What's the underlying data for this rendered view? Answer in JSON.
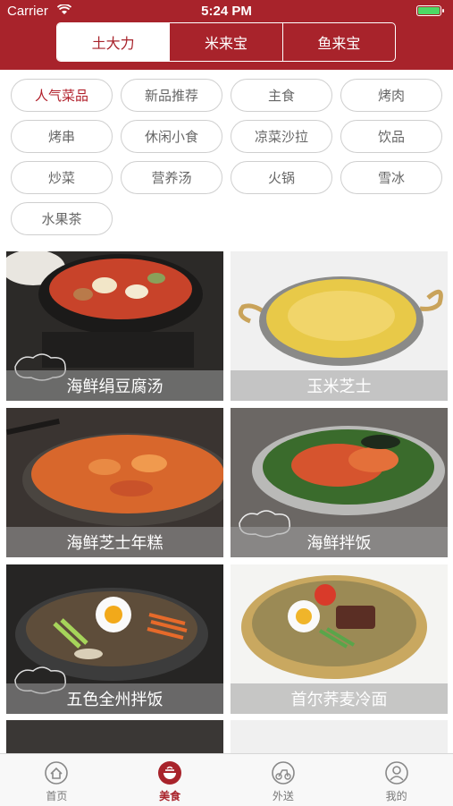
{
  "status_bar": {
    "carrier": "Carrier",
    "time": "5:24 PM"
  },
  "segments": [
    "土大力",
    "米来宝",
    "鱼来宝"
  ],
  "categories": [
    "人气菜品",
    "新品推荐",
    "主食",
    "烤肉",
    "烤串",
    "休闲小食",
    "凉菜沙拉",
    "饮品",
    "炒菜",
    "营养汤",
    "火锅",
    "雪冰",
    "水果茶"
  ],
  "dishes": [
    {
      "name": "海鲜绢豆腐汤"
    },
    {
      "name": "玉米芝士"
    },
    {
      "name": "海鲜芝士年糕"
    },
    {
      "name": "海鲜拌饭"
    },
    {
      "name": "五色全州拌饭"
    },
    {
      "name": "首尔荞麦冷面"
    }
  ],
  "tabbar": [
    {
      "label": "首页",
      "icon": "home-icon"
    },
    {
      "label": "美食",
      "icon": "food-icon"
    },
    {
      "label": "外送",
      "icon": "delivery-icon"
    },
    {
      "label": "我的",
      "icon": "profile-icon"
    }
  ],
  "colors": {
    "brand": "#a8232b",
    "active_category": "#b1202b"
  }
}
